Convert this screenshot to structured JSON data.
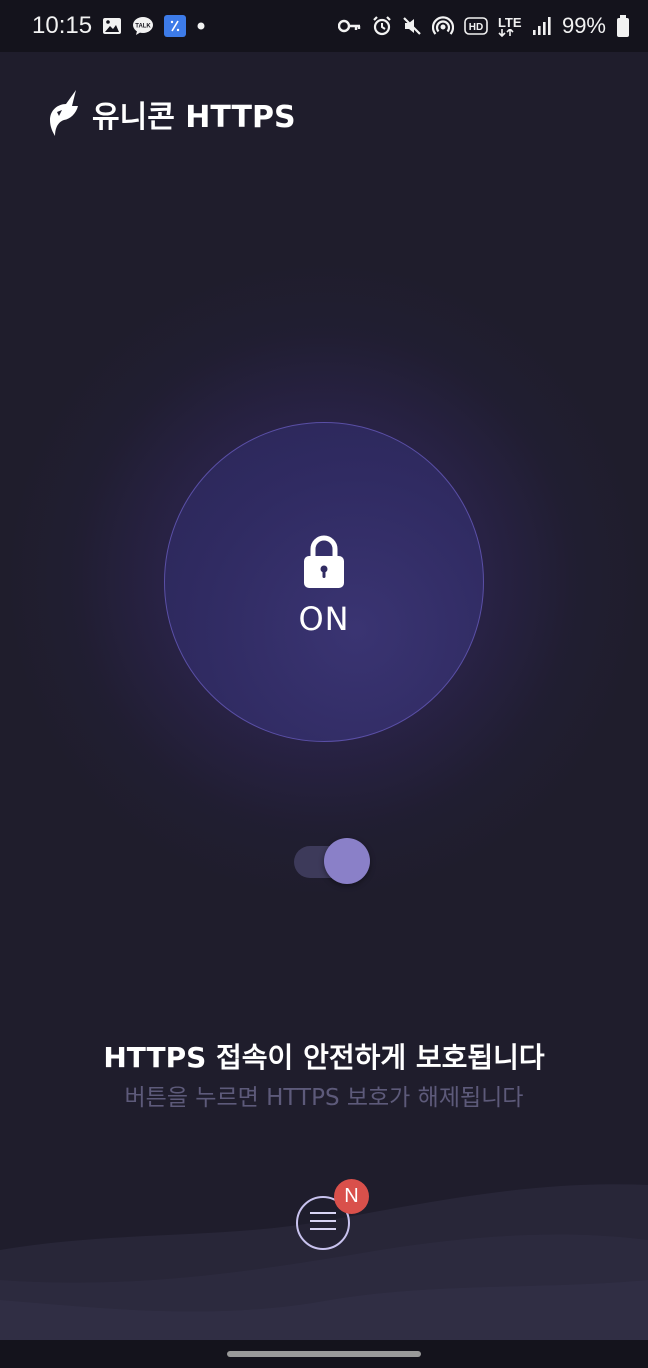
{
  "status_bar": {
    "time": "10:15",
    "battery_text": "99%",
    "network": "LTE",
    "icons": [
      "gallery-icon",
      "kakaotalk-icon",
      "app-icon",
      "dot-icon",
      "key-icon",
      "alarm-icon",
      "mute-icon",
      "hotspot-icon",
      "hd-icon",
      "lte-icon",
      "signal-icon",
      "battery-icon"
    ]
  },
  "header": {
    "title": "유니콘 HTTPS",
    "logo_icon": "unicorn-logo-icon"
  },
  "power": {
    "state_label": "ON",
    "icon": "lock-icon"
  },
  "toggle": {
    "state": "on"
  },
  "message": {
    "title": "HTTPS 접속이 안전하게 보호됩니다",
    "subtitle": "버튼을 누르면 HTTPS 보호가 해제됩니다"
  },
  "menu": {
    "icon": "hamburger-icon",
    "badge": "N"
  },
  "colors": {
    "background": "#1f1d2c",
    "circle": "#302b62",
    "circle_border": "#5a4fa6",
    "toggle_knob": "#8a80c8",
    "badge": "#d9504b",
    "subtitle": "#5d5a7a"
  }
}
